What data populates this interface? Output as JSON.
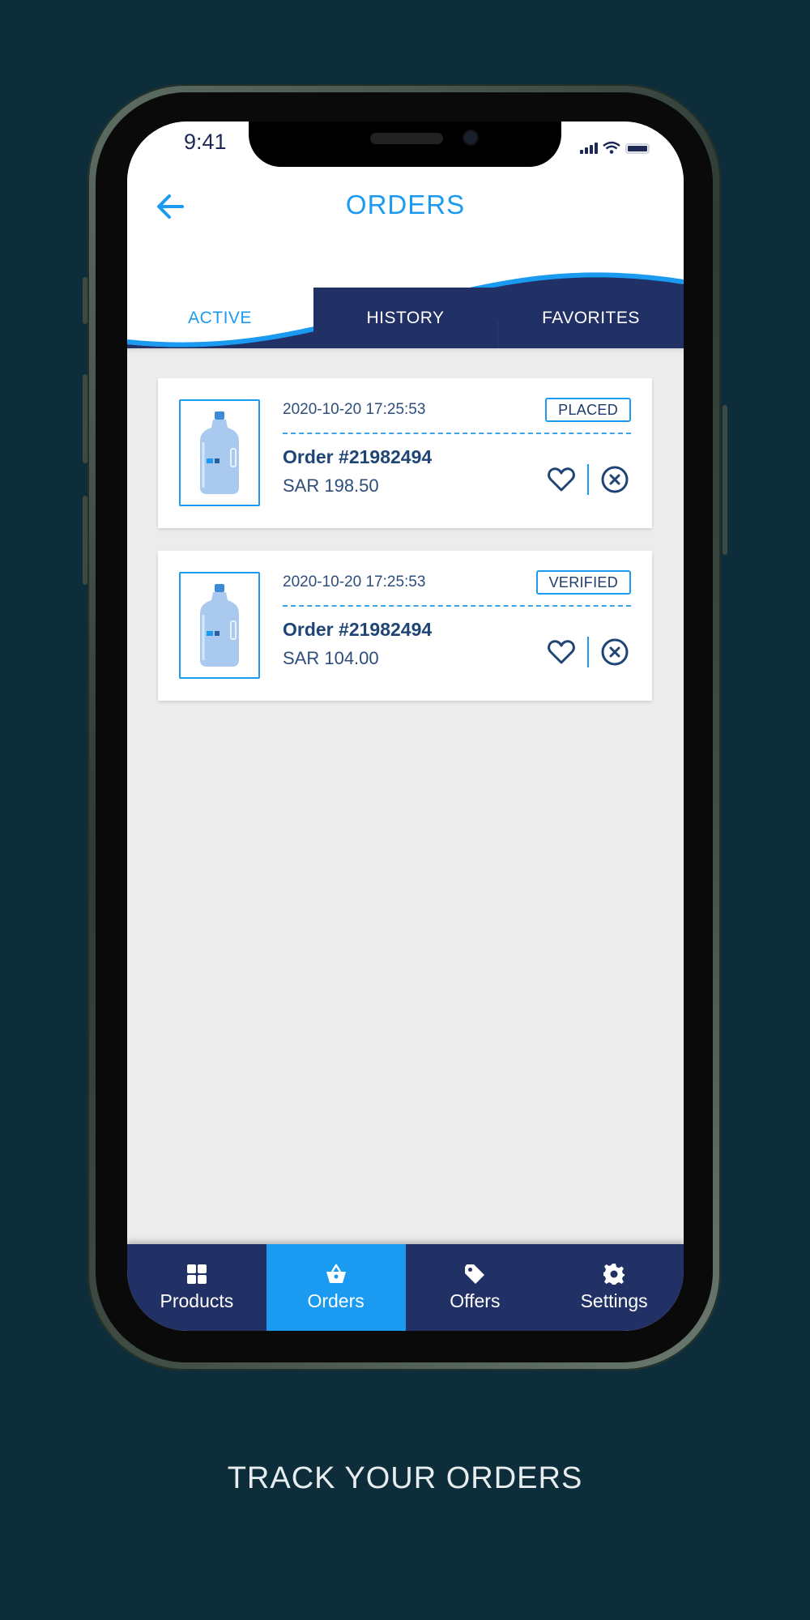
{
  "status_bar": {
    "time": "9:41"
  },
  "header": {
    "title": "ORDERS",
    "back_icon": "arrow-left-icon"
  },
  "tabs": [
    {
      "label": "ACTIVE",
      "active": true
    },
    {
      "label": "HISTORY",
      "active": false
    },
    {
      "label": "FAVORITES",
      "active": false
    }
  ],
  "orders": [
    {
      "date": "2020-10-20 17:25:53",
      "status": "PLACED",
      "order_number": "Order #21982494",
      "price": "SAR 198.50",
      "image": "water-bottle-icon"
    },
    {
      "date": "2020-10-20 17:25:53",
      "status": "VERIFIED",
      "order_number": "Order #21982494",
      "price": "SAR 104.00",
      "image": "water-bottle-icon"
    }
  ],
  "bottom_nav": [
    {
      "label": "Products",
      "icon": "grid-icon",
      "active": false
    },
    {
      "label": "Orders",
      "icon": "basket-icon",
      "active": true
    },
    {
      "label": "Offers",
      "icon": "tag-icon",
      "active": false
    },
    {
      "label": "Settings",
      "icon": "gear-icon",
      "active": false
    }
  ],
  "caption": "TRACK YOUR ORDERS",
  "colors": {
    "background": "#0e2d3a",
    "accent": "#1a9af0",
    "navy": "#213065",
    "text_dark": "#1f4576"
  }
}
